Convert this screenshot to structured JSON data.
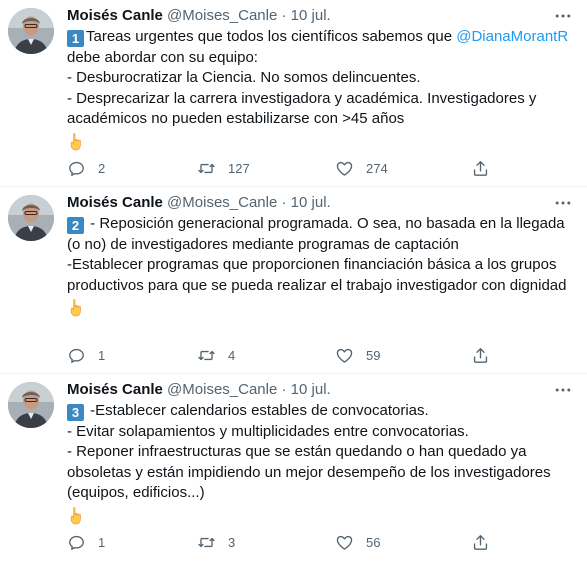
{
  "tweets": [
    {
      "author": "Moisés Canle",
      "handle": "@Moises_Canle",
      "separator": "·",
      "date": "10 jul.",
      "badge": "1",
      "lines": [
        {
          "prefix": "Tareas urgentes que todos los científicos sabemos que ",
          "mention": "@DianaMorantR"
        },
        {
          "text": "debe abordar con su equipo:"
        },
        {
          "text": "- Desburocratizar la Ciencia. No somos delincuentes."
        },
        {
          "text": "- Desprecarizar la carrera investigadora y académica. Investigadores y"
        },
        {
          "text": "académicos no pueden estabilizarse con >45 años"
        }
      ],
      "emoji": "pointing-down-hand-icon",
      "replies": "2",
      "retweets": "127",
      "likes": "274"
    },
    {
      "author": "Moisés Canle",
      "handle": "@Moises_Canle",
      "separator": "·",
      "date": "10 jul.",
      "badge": "2",
      "lines": [
        {
          "prefix": " - Reposición generacional programada. O sea, no basada en la llegada"
        },
        {
          "text": "(o no) de investigadores mediante programas de captación"
        },
        {
          "text": "-Establecer programas que proporcionen financiación básica a los grupos"
        },
        {
          "text": "productivos para que se pueda realizar el trabajo investigador con dignidad"
        }
      ],
      "emoji": "pointing-down-hand-icon",
      "replies": "1",
      "retweets": "4",
      "likes": "59"
    },
    {
      "author": "Moisés Canle",
      "handle": "@Moises_Canle",
      "separator": "·",
      "date": "10 jul.",
      "badge": "3",
      "lines": [
        {
          "prefix": " -Establecer calendarios estables de convocatorias."
        },
        {
          "text": "- Evitar solapamientos y multiplicidades entre convocatorias."
        },
        {
          "text": "- Reponer infraestructuras que se están quedando o han quedado ya"
        },
        {
          "text": "obsoletas y están impidiendo un mejor desempeño de los investigadores"
        },
        {
          "text": "(equipos, edificios...)"
        }
      ],
      "emoji": "pointing-down-hand-icon",
      "replies": "1",
      "retweets": "3",
      "likes": "56"
    }
  ],
  "colors": {
    "text": "#0f1419",
    "secondary": "#536471",
    "mention": "#1d9bf0",
    "keycap": "#3b88c3",
    "divider": "#eff3f4"
  },
  "icons": [
    "more-icon",
    "reply-icon",
    "retweet-icon",
    "like-icon",
    "share-icon",
    "keycap-digit-icon",
    "pointing-down-hand-icon"
  ]
}
